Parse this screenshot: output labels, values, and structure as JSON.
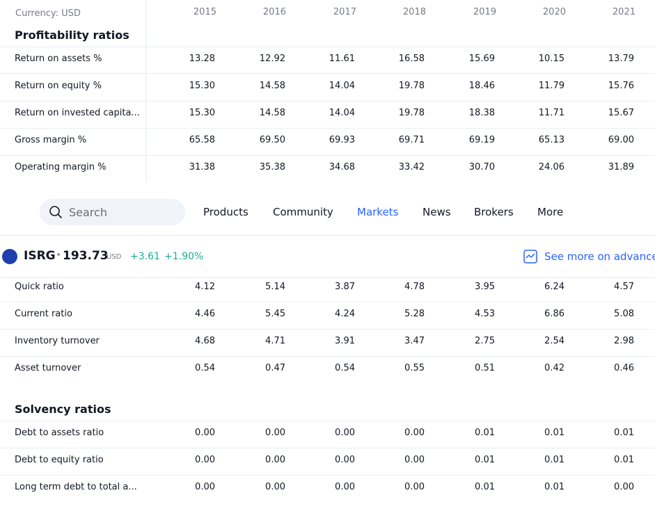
{
  "currency_label": "Currency: USD",
  "years": [
    "2015",
    "2016",
    "2017",
    "2018",
    "2019",
    "2020",
    "2021"
  ],
  "profitability": {
    "title": "Profitability ratios",
    "rows": [
      {
        "label": "Return on assets %",
        "values": [
          "13.28",
          "12.92",
          "11.61",
          "16.58",
          "15.69",
          "10.15",
          "13.79"
        ]
      },
      {
        "label": "Return on equity %",
        "values": [
          "15.30",
          "14.58",
          "14.04",
          "19.78",
          "18.46",
          "11.79",
          "15.76"
        ]
      },
      {
        "label": "Return on invested capita...",
        "values": [
          "15.30",
          "14.58",
          "14.04",
          "19.78",
          "18.38",
          "11.71",
          "15.67"
        ]
      },
      {
        "label": "Gross margin %",
        "values": [
          "65.58",
          "69.50",
          "69.93",
          "69.71",
          "69.19",
          "65.13",
          "69.00"
        ]
      },
      {
        "label": "Operating margin %",
        "values": [
          "31.38",
          "35.38",
          "34.68",
          "33.42",
          "30.70",
          "24.06",
          "31.89"
        ]
      }
    ]
  },
  "nav": {
    "search_placeholder": "Search",
    "items": [
      "Products",
      "Community",
      "Markets",
      "News",
      "Brokers",
      "More"
    ],
    "active": "Markets"
  },
  "ticker": {
    "symbol": "ISRG",
    "separator": "•",
    "price": "193.73",
    "currency": "USD",
    "change": "+3.61",
    "change_pct": "+1.90%",
    "positive_color": "#22ab94",
    "more_link": "See more on advance"
  },
  "liquidity": {
    "rows": [
      {
        "label": "Quick ratio",
        "values": [
          "4.12",
          "5.14",
          "3.87",
          "4.78",
          "3.95",
          "6.24",
          "4.57"
        ]
      },
      {
        "label": "Current ratio",
        "values": [
          "4.46",
          "5.45",
          "4.24",
          "5.28",
          "4.53",
          "6.86",
          "5.08"
        ]
      },
      {
        "label": "Inventory turnover",
        "values": [
          "4.68",
          "4.71",
          "3.91",
          "3.47",
          "2.75",
          "2.54",
          "2.98"
        ]
      },
      {
        "label": "Asset turnover",
        "values": [
          "0.54",
          "0.47",
          "0.54",
          "0.55",
          "0.51",
          "0.42",
          "0.46"
        ]
      }
    ]
  },
  "solvency": {
    "title": "Solvency ratios",
    "rows": [
      {
        "label": "Debt to assets ratio",
        "values": [
          "0.00",
          "0.00",
          "0.00",
          "0.00",
          "0.01",
          "0.01",
          "0.01"
        ]
      },
      {
        "label": "Debt to equity ratio",
        "values": [
          "0.00",
          "0.00",
          "0.00",
          "0.00",
          "0.01",
          "0.01",
          "0.01"
        ]
      },
      {
        "label": "Long term debt to total a...",
        "values": [
          "0.00",
          "0.00",
          "0.00",
          "0.00",
          "0.01",
          "0.01",
          "0.00"
        ]
      }
    ]
  },
  "colors": {
    "accent": "#2962ff",
    "text": "#131722",
    "muted": "#787b86"
  }
}
